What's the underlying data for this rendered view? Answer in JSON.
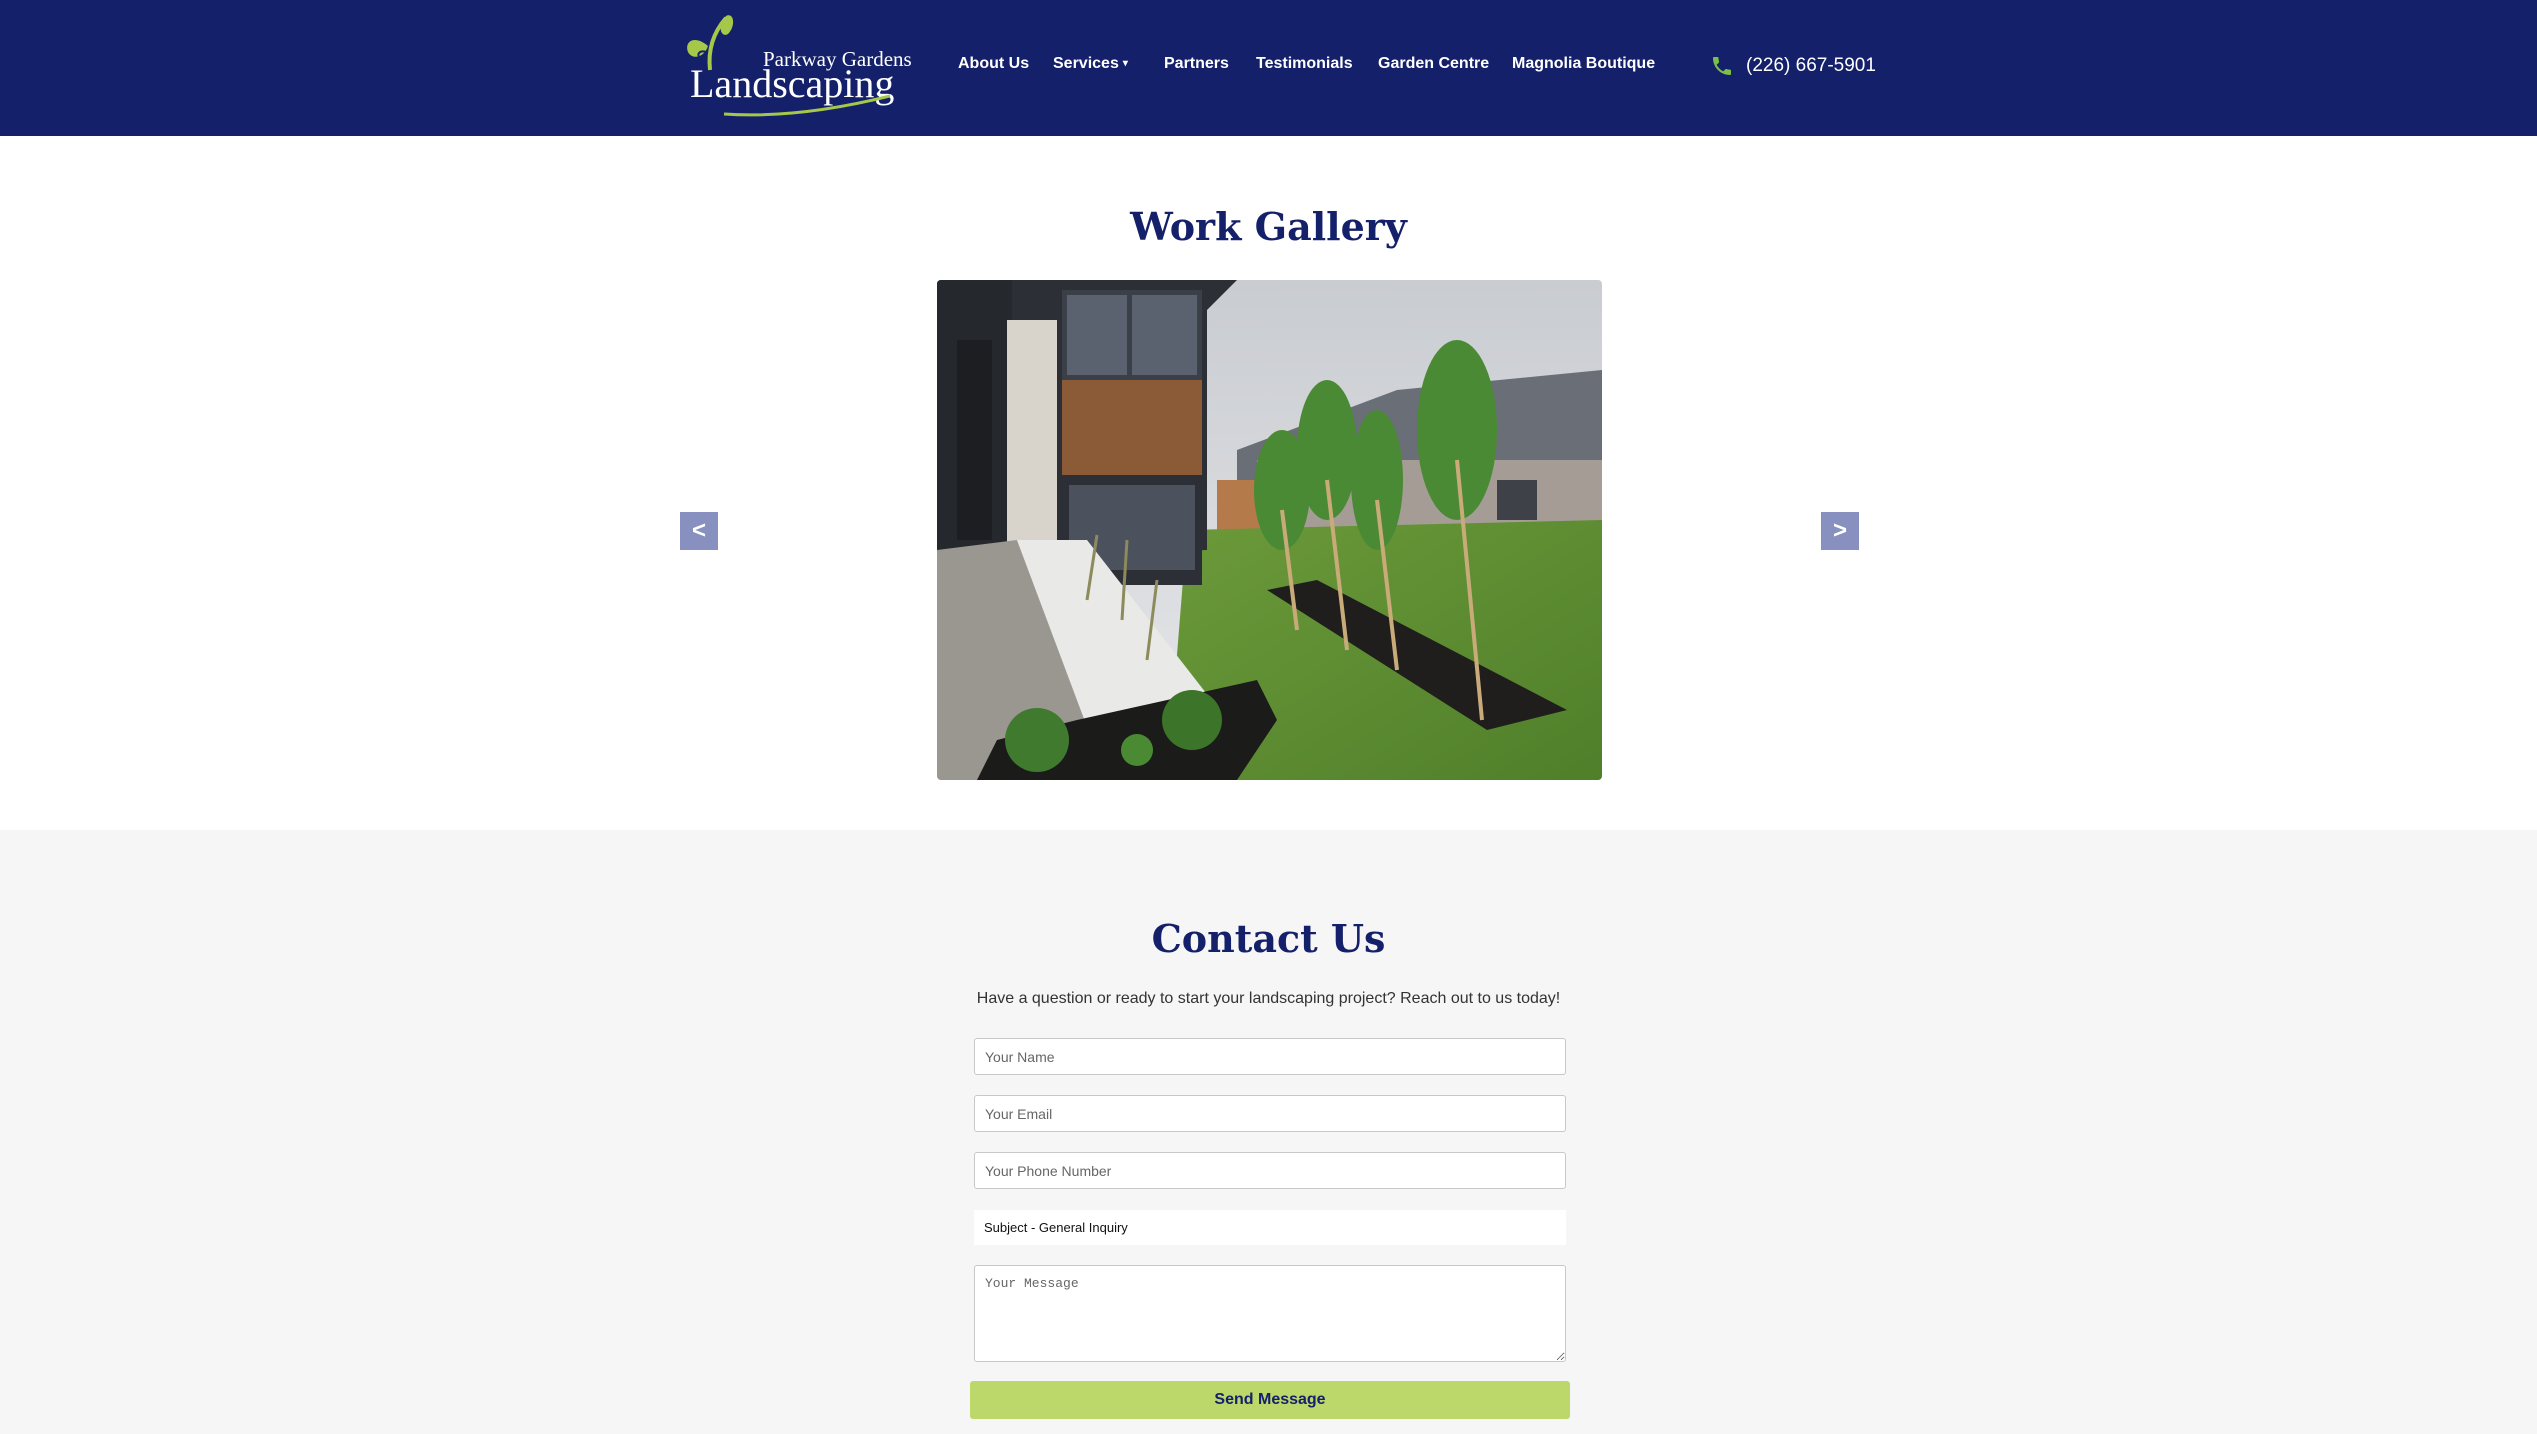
{
  "brand": {
    "small": "Parkway Gardens",
    "big": "Landscaping",
    "icon": "leaf-logo-icon",
    "colors": {
      "primary": "#14206a",
      "accent": "#bcd86b",
      "leaf": "#a6c84a"
    }
  },
  "nav": {
    "items": [
      {
        "label": "About Us"
      },
      {
        "label": "Services",
        "has_dropdown": true,
        "caret": "▾"
      },
      {
        "label": "Partners"
      },
      {
        "label": "Testimonials"
      },
      {
        "label": "Garden Centre"
      },
      {
        "label": "Magnolia Boutique"
      }
    ]
  },
  "phone": {
    "number": "(226) 667-5901",
    "icon": "phone-icon"
  },
  "gallery": {
    "title": "Work Gallery",
    "prev_label": "<",
    "next_label": ">"
  },
  "contact": {
    "title": "Contact Us",
    "subtitle": "Have a question or ready to start your landscaping project? Reach out to us today!",
    "name_placeholder": "Your Name",
    "email_placeholder": "Your Email",
    "phone_placeholder": "Your Phone Number",
    "subject_value": "Subject - General Inquiry",
    "message_placeholder": "Your Message",
    "send_label": "Send Message"
  }
}
